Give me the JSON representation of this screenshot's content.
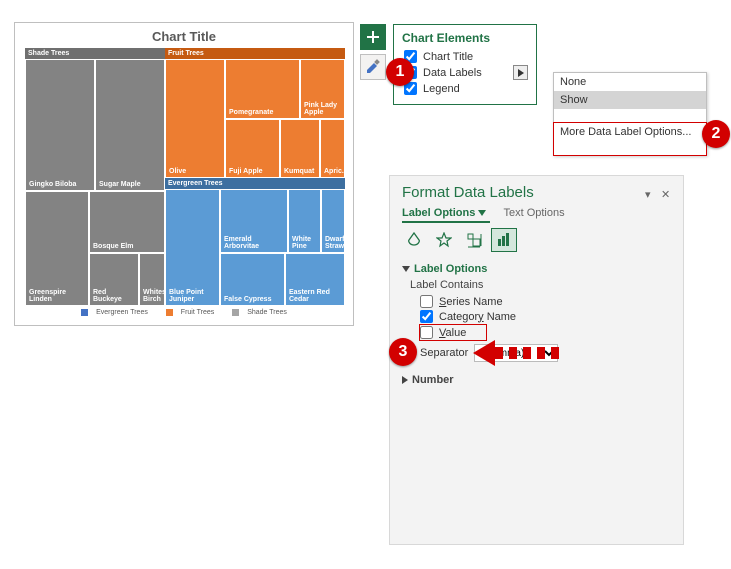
{
  "chart": {
    "title": "Chart Title",
    "legend": {
      "evergreen": "Evergreen Trees",
      "fruit": "Fruit Trees",
      "shade": "Shade Trees"
    },
    "groups": {
      "shade": "Shade Trees",
      "fruit": "Fruit Trees",
      "evergreen": "Evergreen Trees"
    },
    "shade_cells": {
      "gingko": "Gingko Biloba",
      "sugar_maple": "Sugar Maple",
      "greenspire": "Greenspire Linden",
      "bosque": "Bosque Elm",
      "red_buckeye": "Red Buckeye",
      "whitespire": "Whites... Birch"
    },
    "fruit_cells": {
      "olive": "Olive",
      "pomegranate": "Pomegranate",
      "fuji": "Fuji Apple",
      "pink_lady": "Pink Lady Apple",
      "kumquat": "Kumquat",
      "apricot": "Apric..."
    },
    "evergreen_cells": {
      "bluepoint": "Blue Point Juniper",
      "emerald": "Emerald Arborvitae",
      "false_cypress": "False Cypress",
      "white_pine": "White Pine",
      "eastern_red": "Eastern Red Cedar",
      "dwarf_strawberry": "Dwarf Strawberry"
    }
  },
  "flyout": {
    "header": "Chart Elements",
    "chart_title": "Chart Title",
    "data_labels": "Data Labels",
    "legend": "Legend"
  },
  "submenu": {
    "none": "None",
    "show": "Show",
    "more": "More Data Label Options..."
  },
  "pane": {
    "title": "Format Data Labels",
    "label_options": "Label Options",
    "text_options": "Text Options",
    "section_label_options": "Label Options",
    "label_contains": "Label Contains",
    "series_name": "Series Name",
    "category_name": "Category Name",
    "value": "Value",
    "separator": "Separator",
    "separator_value": ", (comma)",
    "number": "Number"
  },
  "badges": {
    "one": "1",
    "two": "2",
    "three": "3"
  },
  "chart_data": {
    "type": "treemap",
    "title": "Chart Title",
    "series": [
      {
        "name": "Shade Trees",
        "color": "#838383",
        "items": [
          {
            "name": "Gingko Biloba"
          },
          {
            "name": "Sugar Maple"
          },
          {
            "name": "Greenspire Linden"
          },
          {
            "name": "Bosque Elm"
          },
          {
            "name": "Red Buckeye"
          },
          {
            "name": "Whitespire Birch"
          }
        ]
      },
      {
        "name": "Fruit Trees",
        "color": "#ed7d31",
        "items": [
          {
            "name": "Olive"
          },
          {
            "name": "Pomegranate"
          },
          {
            "name": "Fuji Apple"
          },
          {
            "name": "Pink Lady Apple"
          },
          {
            "name": "Kumquat"
          },
          {
            "name": "Apricot"
          }
        ]
      },
      {
        "name": "Evergreen Trees",
        "color": "#5b9bd5",
        "items": [
          {
            "name": "Blue Point Juniper"
          },
          {
            "name": "Emerald Arborvitae"
          },
          {
            "name": "False Cypress"
          },
          {
            "name": "White Pine"
          },
          {
            "name": "Eastern Red Cedar"
          },
          {
            "name": "Dwarf Strawberry"
          }
        ]
      }
    ],
    "legend": [
      "Evergreen Trees",
      "Fruit Trees",
      "Shade Trees"
    ]
  }
}
